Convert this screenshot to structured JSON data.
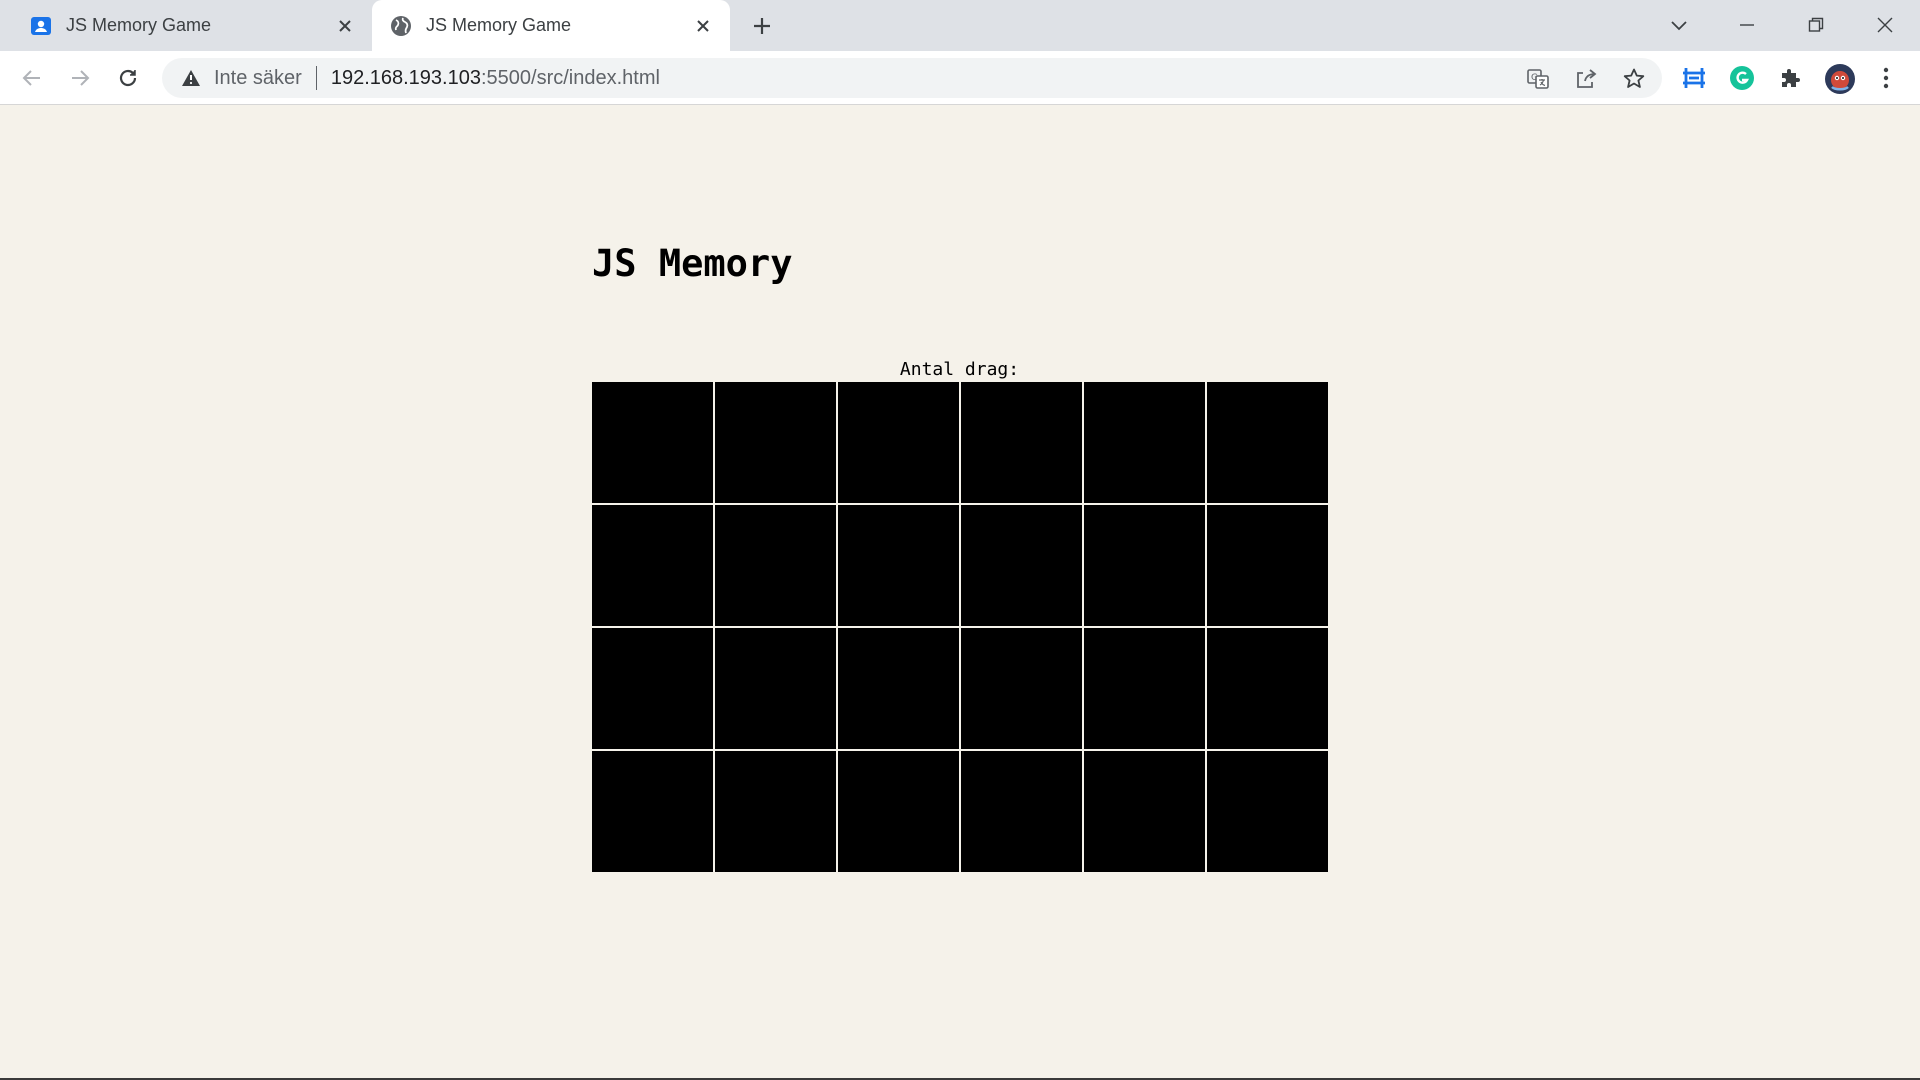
{
  "browser": {
    "tabs": [
      {
        "title": "JS Memory Game",
        "favicon": "contacts-icon",
        "active": false
      },
      {
        "title": "JS Memory Game",
        "favicon": "globe-icon",
        "active": true
      }
    ],
    "address_bar": {
      "security_label": "Inte säker",
      "url_host": "192.168.193.103",
      "url_path": ":5500/src/index.html"
    },
    "accent_colors": {
      "grammarly": "#15c39a",
      "extension_blue": "#1a73e8"
    }
  },
  "page": {
    "title": "JS Memory",
    "moves_label": "Antal drag:",
    "board": {
      "rows": 4,
      "columns": 6,
      "cards_face_down": 24,
      "card_color": "#000000"
    },
    "background_color": "#f5f2ea"
  }
}
